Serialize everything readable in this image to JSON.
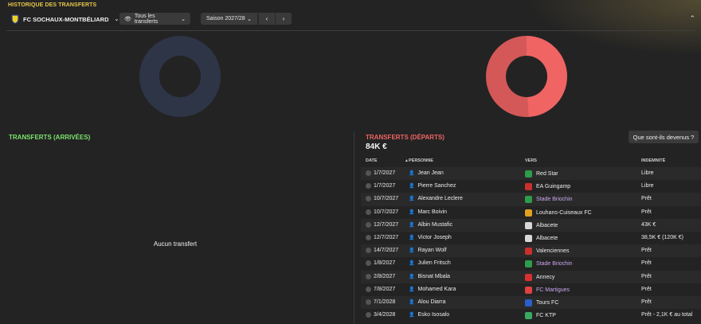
{
  "header": {
    "section_title": "HISTORIQUE DES TRANSFERTS",
    "club_name": "FC SOCHAUX-MONTBÉLIARD",
    "filter_label": "Tous les transferts",
    "season_label": "Saison 2027/28"
  },
  "colors": {
    "arrivals_accent": "#7de36f",
    "departures_accent": "#f06464",
    "section_accent": "#e7c64a"
  },
  "arrivals": {
    "title": "TRANSFERTS (ARRIVÉES)",
    "empty_text": "Aucun transfert"
  },
  "departures": {
    "title": "TRANSFERTS (DÉPARTS)",
    "total": "84K €",
    "button_label": "Que sont-ils devenus ?",
    "columns": {
      "date": "DATE",
      "person": "PERSONNE",
      "to": "VERS",
      "fee": "INDEMNITÉ"
    },
    "rows": [
      {
        "date": "1/7/2027",
        "person": "Jean Jean",
        "to": "Red Star",
        "fee": "Libre",
        "link": false,
        "crest": "#2e9c4a"
      },
      {
        "date": "1/7/2027",
        "person": "Pierre Sanchez",
        "to": "EA Guingamp",
        "fee": "Libre",
        "link": false,
        "crest": "#c9302c"
      },
      {
        "date": "10/7/2027",
        "person": "Alexandre Leclere",
        "to": "Stade Briochin",
        "fee": "Prêt",
        "link": true,
        "crest": "#2e9c4a"
      },
      {
        "date": "10/7/2027",
        "person": "Marc Boivin",
        "to": "Louhans-Cuiseaux FC",
        "fee": "Prêt",
        "link": false,
        "crest": "#e0a020"
      },
      {
        "date": "12/7/2027",
        "person": "Albin Mustafic",
        "to": "Albacete",
        "fee": "43K €",
        "link": false,
        "crest": "#d8d8d8"
      },
      {
        "date": "12/7/2027",
        "person": "Victor Joseph",
        "to": "Albacete",
        "fee": "38,5K € (120K €)",
        "link": false,
        "crest": "#d8d8d8"
      },
      {
        "date": "14/7/2027",
        "person": "Rayan Wolf",
        "to": "Valenciennes",
        "fee": "Prêt",
        "link": false,
        "crest": "#c9302c"
      },
      {
        "date": "1/8/2027",
        "person": "Julien Fritsch",
        "to": "Stade Briochin",
        "fee": "Prêt",
        "link": true,
        "crest": "#2e9c4a"
      },
      {
        "date": "2/8/2027",
        "person": "Bisnat Mbala",
        "to": "Annecy",
        "fee": "Prêt",
        "link": false,
        "crest": "#d83030"
      },
      {
        "date": "7/8/2027",
        "person": "Mohamed Kara",
        "to": "FC Martigues",
        "fee": "Prêt",
        "link": true,
        "crest": "#e04040"
      },
      {
        "date": "7/1/2028",
        "person": "Alou Diarra",
        "to": "Tours FC",
        "fee": "Prêt",
        "link": false,
        "crest": "#2a5fc9"
      },
      {
        "date": "3/4/2028",
        "person": "Esko Isosalo",
        "to": "FC KTP",
        "fee": "Prêt - 2,1K € au total",
        "link": false,
        "crest": "#3aa860"
      }
    ]
  }
}
